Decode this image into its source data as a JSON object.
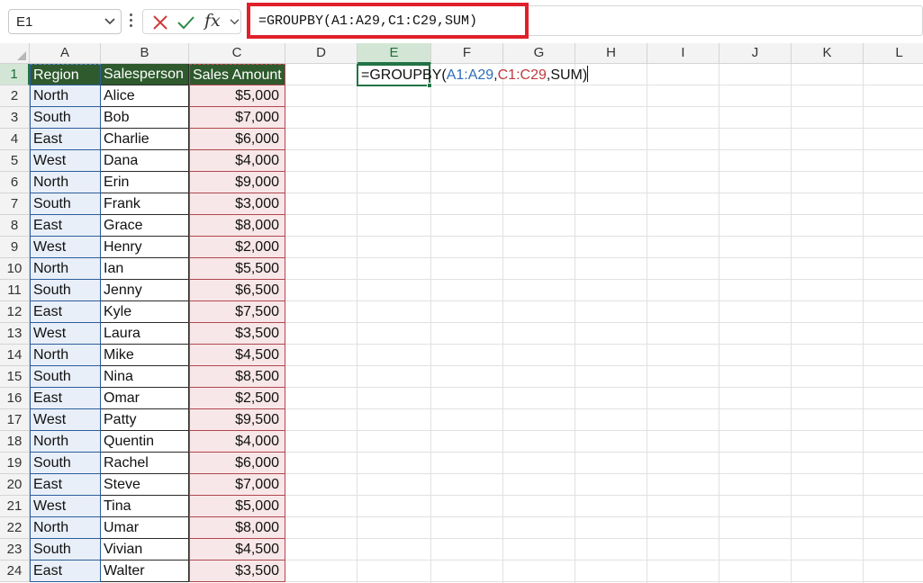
{
  "name_box": {
    "value": "E1"
  },
  "formula_bar": {
    "formula": "=GROUPBY(A1:A29,C1:C29,SUM)",
    "cancel_icon": "x-icon",
    "enter_icon": "check-icon",
    "fx_label": "fx"
  },
  "in_cell_formula": {
    "prefix": "=GROUPBY(",
    "ref_a": "A1:A29",
    "sep1": ",",
    "ref_c": "C1:C29",
    "suffix": ",SUM)"
  },
  "colors": {
    "header_fill": "#2e5a2e",
    "region_fill": "#e9eff8",
    "amount_fill": "#f8e7e8",
    "selection": "#217346",
    "highlight_border": "#e0202a",
    "ref_a_color": "#2f6db5",
    "ref_c_color": "#c0393e"
  },
  "columns": [
    "A",
    "B",
    "C",
    "D",
    "E",
    "F",
    "G",
    "H",
    "I",
    "J",
    "K",
    "L"
  ],
  "selected_column": "E",
  "row_numbers": [
    "1",
    "2",
    "3",
    "4",
    "5",
    "6",
    "7",
    "8",
    "9",
    "10",
    "11",
    "12",
    "13",
    "14",
    "15",
    "16",
    "17",
    "18",
    "19",
    "20",
    "21",
    "22",
    "23",
    "24"
  ],
  "selected_row": "1",
  "table": {
    "headers": [
      "Region",
      "Salesperson",
      "Sales Amount"
    ],
    "rows": [
      [
        "North",
        "Alice",
        "$5,000"
      ],
      [
        "South",
        "Bob",
        "$7,000"
      ],
      [
        "East",
        "Charlie",
        "$6,000"
      ],
      [
        "West",
        "Dana",
        "$4,000"
      ],
      [
        "North",
        "Erin",
        "$9,000"
      ],
      [
        "South",
        "Frank",
        "$3,000"
      ],
      [
        "East",
        "Grace",
        "$8,000"
      ],
      [
        "West",
        "Henry",
        "$2,000"
      ],
      [
        "North",
        "Ian",
        "$5,500"
      ],
      [
        "South",
        "Jenny",
        "$6,500"
      ],
      [
        "East",
        "Kyle",
        "$7,500"
      ],
      [
        "West",
        "Laura",
        "$3,500"
      ],
      [
        "North",
        "Mike",
        "$4,500"
      ],
      [
        "South",
        "Nina",
        "$8,500"
      ],
      [
        "East",
        "Omar",
        "$2,500"
      ],
      [
        "West",
        "Patty",
        "$9,500"
      ],
      [
        "North",
        "Quentin",
        "$4,000"
      ],
      [
        "South",
        "Rachel",
        "$6,000"
      ],
      [
        "East",
        "Steve",
        "$7,000"
      ],
      [
        "West",
        "Tina",
        "$5,000"
      ],
      [
        "North",
        "Umar",
        "$8,000"
      ],
      [
        "South",
        "Vivian",
        "$4,500"
      ],
      [
        "East",
        "Walter",
        "$3,500"
      ]
    ]
  }
}
